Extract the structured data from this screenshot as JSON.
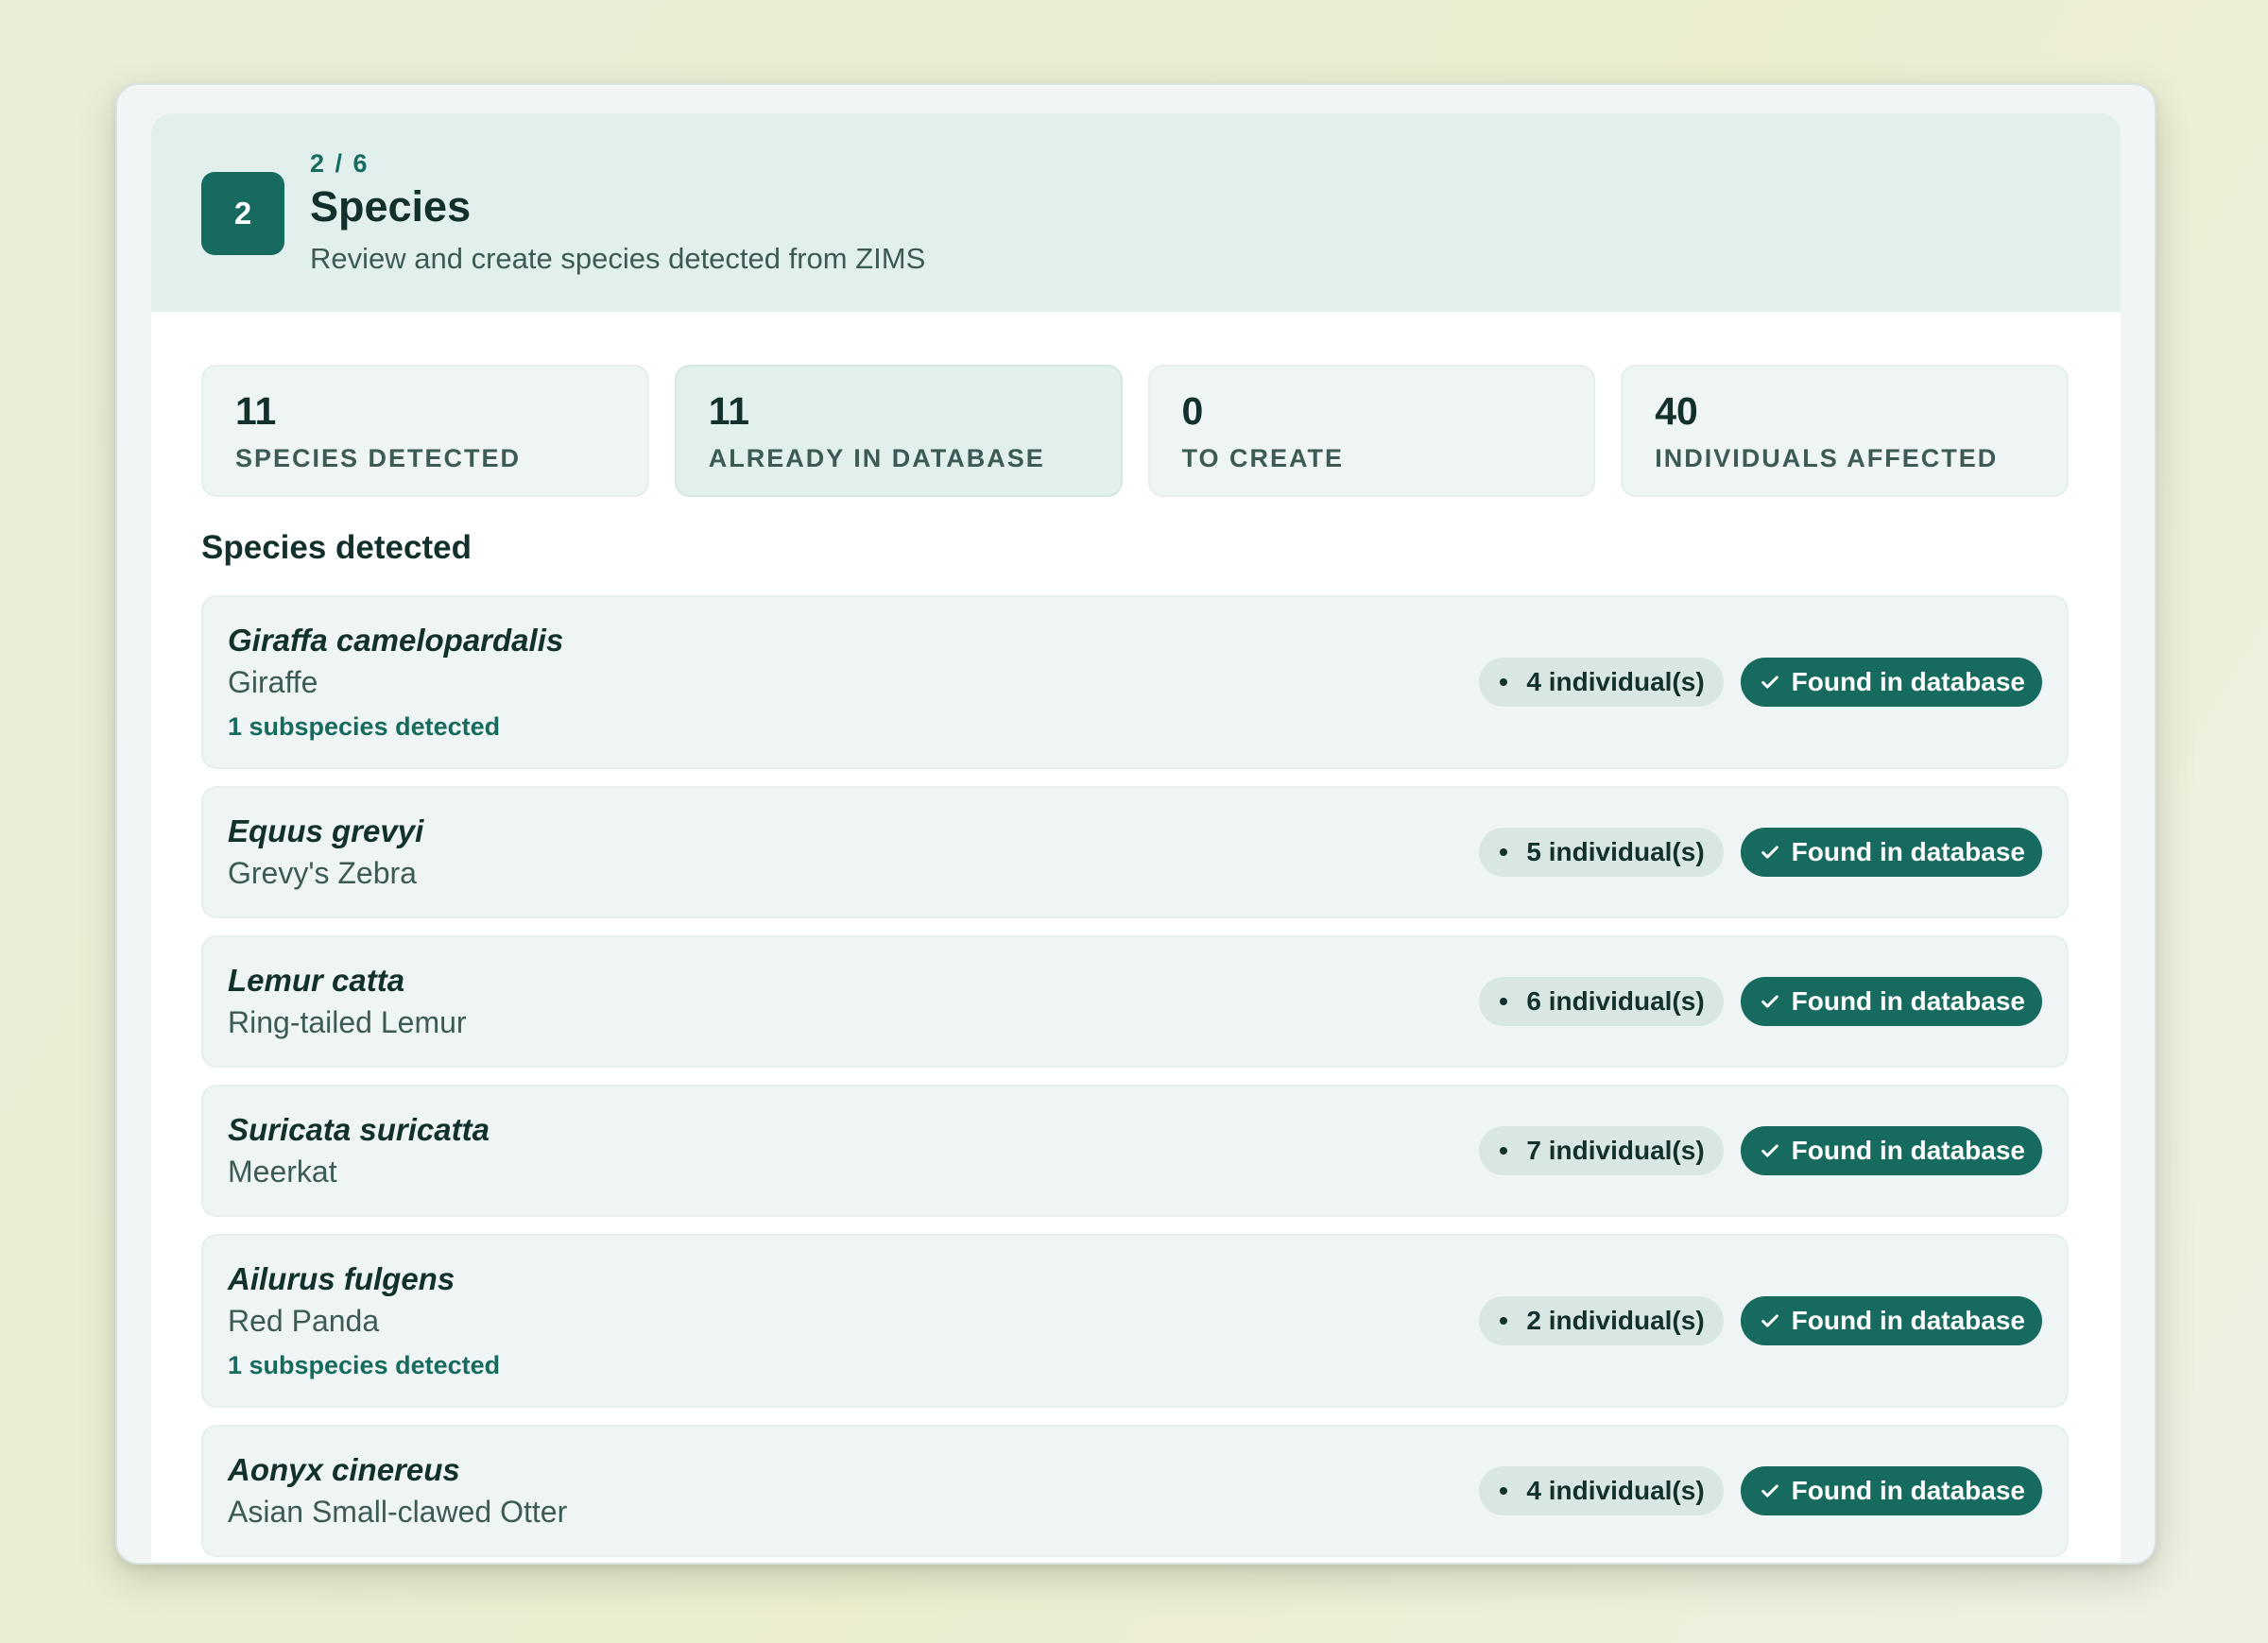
{
  "header": {
    "step_number": "2",
    "step_progress": "2 / 6",
    "title": "Species",
    "subtitle": "Review and create species detected from ZIMS"
  },
  "stats": [
    {
      "value": "11",
      "label": "SPECIES DETECTED",
      "highlighted": false
    },
    {
      "value": "11",
      "label": "ALREADY IN DATABASE",
      "highlighted": true
    },
    {
      "value": "0",
      "label": "TO CREATE",
      "highlighted": false
    },
    {
      "value": "40",
      "label": "INDIVIDUALS AFFECTED",
      "highlighted": false
    }
  ],
  "section_title": "Species detected",
  "species": [
    {
      "scientific_name": "Giraffa camelopardalis",
      "common_name": "Giraffe",
      "subspecies": "1 subspecies detected",
      "individuals": "4 individual(s)",
      "status": "Found in database"
    },
    {
      "scientific_name": "Equus grevyi",
      "common_name": "Grevy's Zebra",
      "subspecies": "",
      "individuals": "5 individual(s)",
      "status": "Found in database"
    },
    {
      "scientific_name": "Lemur catta",
      "common_name": "Ring-tailed Lemur",
      "subspecies": "",
      "individuals": "6 individual(s)",
      "status": "Found in database"
    },
    {
      "scientific_name": "Suricata suricatta",
      "common_name": "Meerkat",
      "subspecies": "",
      "individuals": "7 individual(s)",
      "status": "Found in database"
    },
    {
      "scientific_name": "Ailurus fulgens",
      "common_name": "Red Panda",
      "subspecies": "1 subspecies detected",
      "individuals": "2 individual(s)",
      "status": "Found in database"
    },
    {
      "scientific_name": "Aonyx cinereus",
      "common_name": "Asian Small-clawed Otter",
      "subspecies": "",
      "individuals": "4 individual(s)",
      "status": "Found in database"
    }
  ],
  "icons": {
    "count_badge": "bullet-icon",
    "status_badge": "check-icon"
  },
  "colors": {
    "accent": "#176a5e",
    "header_bg": "#e1efed",
    "card_bg": "#eff5f5",
    "count_pill_bg": "#d8e6e4"
  }
}
